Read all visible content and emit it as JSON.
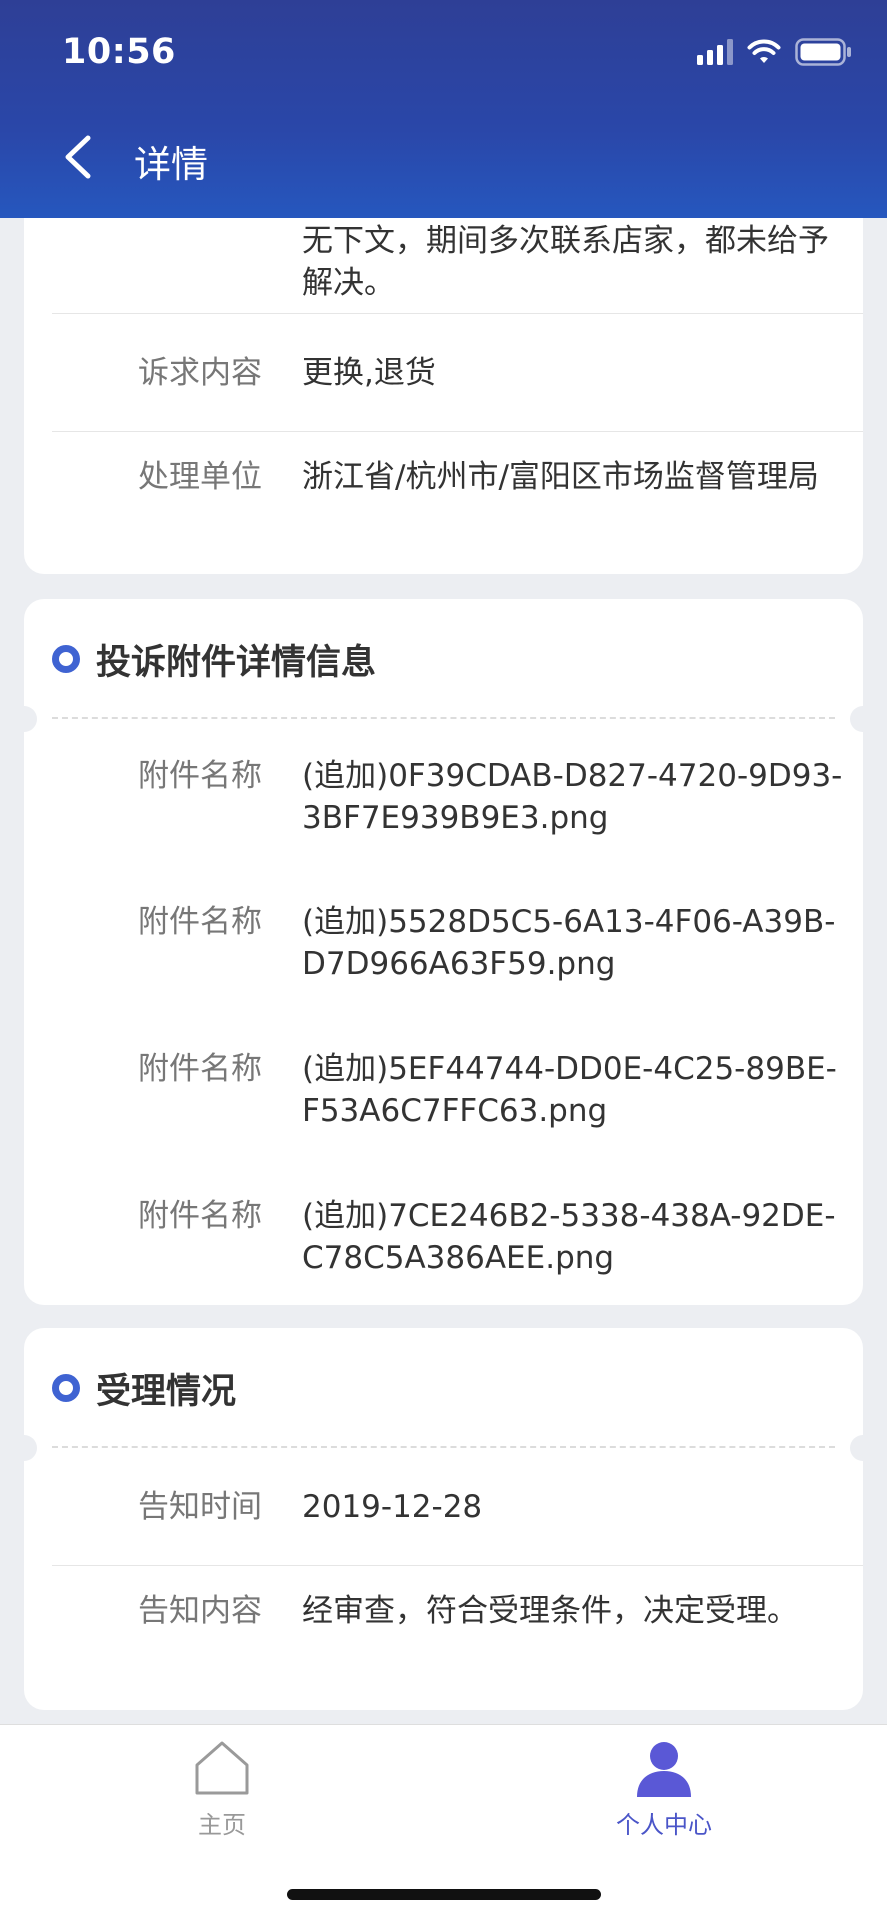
{
  "status_bar": {
    "time": "10:56"
  },
  "header": {
    "title": "详情"
  },
  "cards": {
    "complaint": {
      "overflow_text": "无下文，期间多次联系店家，都未给予解决。",
      "rows": [
        {
          "label": "诉求内容",
          "value": "更换,退货"
        },
        {
          "label": "处理单位",
          "value": "浙江省/杭州市/富阳区市场监督管理局"
        }
      ]
    },
    "attachments": {
      "title": "投诉附件详情信息",
      "rows": [
        {
          "label": "附件名称",
          "value": "(追加)0F39CDAB-D827-4720-9D93-3BF7E939B9E3.png"
        },
        {
          "label": "附件名称",
          "value": "(追加)5528D5C5-6A13-4F06-A39B-D7D966A63F59.png"
        },
        {
          "label": "附件名称",
          "value": "(追加)5EF44744-DD0E-4C25-89BE-F53A6C7FFC63.png"
        },
        {
          "label": "附件名称",
          "value": "(追加)7CE246B2-5338-438A-92DE-C78C5A386AEE.png"
        }
      ]
    },
    "acceptance": {
      "title": "受理情况",
      "rows": [
        {
          "label": "告知时间",
          "value": "2019-12-28"
        },
        {
          "label": "告知内容",
          "value": "经审查，符合受理条件，决定受理。"
        }
      ]
    }
  },
  "tabbar": {
    "items": [
      {
        "label": "主页",
        "icon": "home-icon",
        "active": false
      },
      {
        "label": "个人中心",
        "icon": "person-icon",
        "active": true
      }
    ],
    "active_color": "#4a55c8",
    "inactive_color": "#999999"
  },
  "colors": {
    "header_start": "#2e3f96",
    "header_end": "#2657be",
    "accent": "#3f63d2"
  }
}
